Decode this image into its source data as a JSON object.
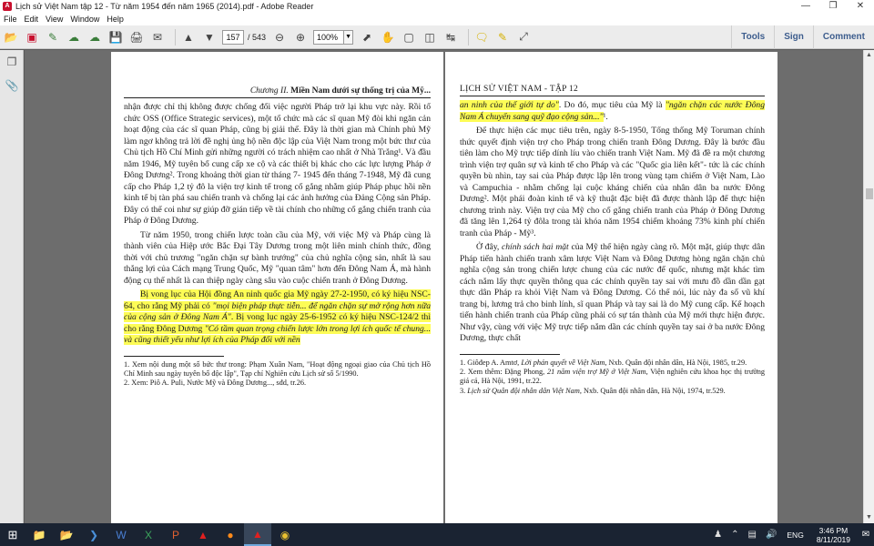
{
  "window": {
    "title": "Lịch sử Việt Nam tập 12 - Từ năm 1954 đến năm 1965 (2014).pdf - Adobe Reader",
    "app_icon": "pdf-icon",
    "controls": [
      "minimize-icon",
      "restore-icon",
      "close-icon"
    ]
  },
  "menu": [
    "File",
    "Edit",
    "View",
    "Window",
    "Help"
  ],
  "toolbar": {
    "page_current": "157",
    "page_total": "/ 543",
    "zoom": "100%",
    "tools_label": "Tools",
    "sign_label": "Sign",
    "comment_label": "Comment"
  },
  "left_page": {
    "running_head_italic": "Chương II.",
    "running_head_bold": "Miền Nam dưới sự thống trị của Mỹ...",
    "p1": "nhận được chỉ thị không được chống đối việc người Pháp trở lại khu vực này. Rồi tổ chức OSS (Office Strategic services), một tổ chức mà các sĩ quan Mỹ đòi khi ngăn cản hoạt động của các sĩ quan Pháp, cũng bị giải thể. Đây là thời gian mà Chính phủ Mỹ làm ngơ không trả lời đề nghị ủng hộ nền độc lập của Việt Nam trong một bức thư của Chủ tịch Hồ Chí Minh gửi những người có trách nhiệm cao nhất ở Nhà Trắng¹. Và đầu năm 1946, Mỹ tuyên bố cung cấp xe cộ và các thiết bị khác cho các lực lượng Pháp ở Đông Dương². Trong khoảng thời gian từ tháng 7- 1945 đến tháng 7-1948, Mỹ đã cung cấp cho Pháp 1,2 tỷ đô la viện trợ kinh tế trong cố gắng nhằm giúp Pháp phục hồi nền kinh tế bị tàn phá sau chiến tranh và chống lại các ảnh hưởng của Đảng Cộng sản Pháp. Đây có thể coi như sự giúp đỡ gián tiếp về tài chính cho những cố gắng chiến tranh của Pháp ở Đông Dương.",
    "p2": "Từ năm 1950, trong chiến lược toàn cầu của Mỹ, với việc Mỹ và Pháp cùng là thành viên của Hiệp ước Bắc Đại Tây Dương trong một liên minh chính thức, đồng thời với chủ trương \"ngăn chặn sự bành trướng\" của chủ nghĩa cộng sản, nhất là sau thắng lợi của Cách mạng Trung Quốc, Mỹ \"quan tâm\" hơn đến Đông Nam Á, mà hành động cụ thể nhất là can thiệp ngày càng sâu vào cuộc chiến tranh ở Đông Dương.",
    "p3a": "Bị vong lục của Hội đồng An ninh quốc gia Mỹ ngày 27-2-1950, có ký hiệu NSC-64, cho rằng Mỹ phải có ",
    "p3b": "\"mọi biện pháp thực tiễn... để ngăn chặn sự mở rộng hơn nữa của cộng sản ở Đông Nam Á\"",
    "p3c": ". Bị vong lục ngày 25-6-1952 có ký hiệu NSC-124/2 thì cho rằng Đông Dương ",
    "p3d": "\"Có tầm quan trọng chiến lược lớn trong lợi ích quốc tế chung... và cũng thiết yếu như lợi ích của Pháp đối với nền",
    "fn1": "1. Xem nội dung một số bức thư trong: Phạm Xuân Nam, \"Hoạt động ngoại giao của Chủ tịch Hồ Chí Minh sau ngày tuyên bố độc lập\", Tạp chí Nghiên cứu Lịch sử số 5/1990.",
    "fn2": "2. Xem: Piô A. Puli, Nước Mỹ và Đông Dương..., sđd, tr.26."
  },
  "right_page": {
    "running_head": "LỊCH SỬ VIỆT NAM - TẬP 12",
    "p1a": "an ninh của thế giới tự do\"",
    "p1b": ". Do đó, mục tiêu của Mỹ là ",
    "p1c": "\"ngăn chặn các nước Đông Nam Á chuyển sang quỹ đạo cộng sản...\"",
    "p1d": "¹.",
    "p2": "Để thực hiện các mục tiêu trên, ngày 8-5-1950, Tổng thống Mỹ Toruman chính thức quyết định viện trợ cho Pháp trong chiến tranh Đông Dương. Đây là bước đầu tiên làm cho Mỹ trực tiếp dính líu vào chiến tranh Việt Nam. Mỹ đã đề ra một chương trình viện trợ quân sự và kinh tế cho Pháp và các \"Quốc gia liên kết\"- tức là các chính quyền bù nhìn, tay sai của Pháp được lập lên trong vùng tạm chiếm ở Việt Nam, Lào và Campuchia - nhằm chống lại cuộc kháng chiến của nhân dân ba nước Đông Dương². Một phái đoàn kinh tế và kỹ thuật đặc biệt đã được thành lập để thực hiện chương trình này. Viện trợ của Mỹ cho cố gắng chiến tranh của Pháp ở Đông Dương đã tăng lên 1,264 tỷ đôla trong tài khóa năm 1954 chiếm khoảng 73% kinh phí chiến tranh của Pháp - Mỹ³.",
    "p3a": "Ở đây, ",
    "p3b": "chính sách hai mặt",
    "p3c": " của Mỹ thể hiện ngày càng rõ. Một mặt, giúp thực dân Pháp tiến hành chiến tranh xâm lược Việt Nam và Đông Dương hòng ngăn chặn chủ nghĩa cộng sản trong chiến lược chung của các nước đế quốc, nhưng mặt khác tìm cách nắm lấy thực quyền thông qua các chính quyền tay sai với mưu đồ dần dần gạt thực dân Pháp ra khỏi Việt Nam và Đông Dương. Có thể nói, lúc này đa số vũ khí trang bị, lương trả cho binh lính, sĩ quan Pháp và tay sai là do Mỹ cung cấp. Kế hoạch tiến hành chiến tranh của Pháp cũng phải có sự tán thành của Mỹ mới thực hiện được. Như vậy, cùng với việc Mỹ trực tiếp nắm dần các chính quyền tay sai ở ba nước Đông Dương, thực chất",
    "fn1a": "1. Giôđep A. Amtơ, ",
    "fn1b": "Lời phán quyết về Việt Nam",
    "fn1c": ", Nxb. Quân đội nhân dân, Hà Nội, 1985, tr.29.",
    "fn2a": "2. Xem thêm: Đặng Phong, ",
    "fn2b": "21 năm viện trợ Mỹ ở Việt Nam",
    "fn2c": ", Viện nghiên cứu khoa học thị trường giá cả, Hà Nội, 1991, tr.22.",
    "fn3a": "3. ",
    "fn3b": "Lịch sử Quân đội nhân dân Việt Nam",
    "fn3c": ", Nxb. Quân đội nhân dân, Hà Nội, 1974, tr.529."
  },
  "taskbar": {
    "language": "ENG",
    "time": "3:46 PM",
    "date": "8/11/2019",
    "colors": {
      "bg": "#1a2332",
      "highlight": "#fdfc56"
    }
  }
}
